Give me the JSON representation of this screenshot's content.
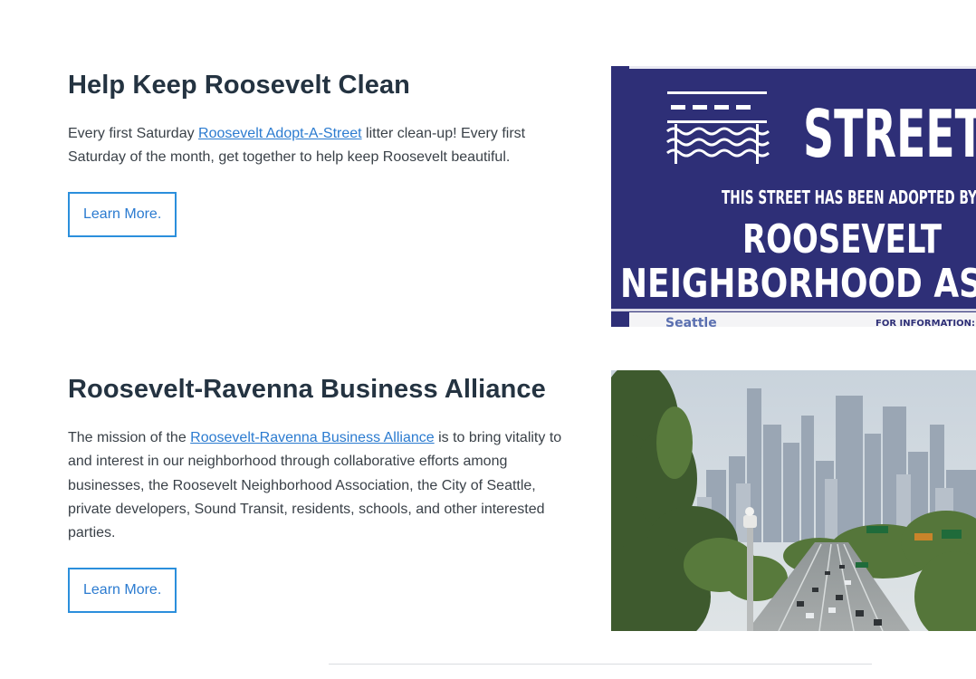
{
  "sections": [
    {
      "title": "Help Keep Roosevelt Clean",
      "text_before": "Every first Saturday ",
      "link": "Roosevelt Adopt-A-Street",
      "text_after": " litter clean-up! Every first Saturday of the month, get together to help keep Roosevelt beautiful.",
      "button": "Learn More.",
      "sign": {
        "street": "STREET",
        "adopted": "THIS STREET HAS BEEN ADOPTED BY",
        "line1": "ROOSEVELT",
        "line2": "NEIGHBORHOOD AS",
        "footer_left": "Seattle",
        "footer_right": "FOR INFORMATION:"
      }
    },
    {
      "title": "Roosevelt-Ravenna Business Alliance",
      "text_before": "The mission of the ",
      "link": "Roosevelt-Ravenna Business Alliance",
      "text_after": " is to bring vitality to and interest in our neighborhood through collaborative efforts among businesses, the Roosevelt Neighborhood Association, the City of Seattle, private developers, Sound Transit, residents, schools, and other interested parties.",
      "button": "Learn More."
    }
  ],
  "colors": {
    "link": "#2b7bd0",
    "button_border": "#2b8fdc",
    "heading": "#243341",
    "sign_bg": "#2e2f77"
  }
}
